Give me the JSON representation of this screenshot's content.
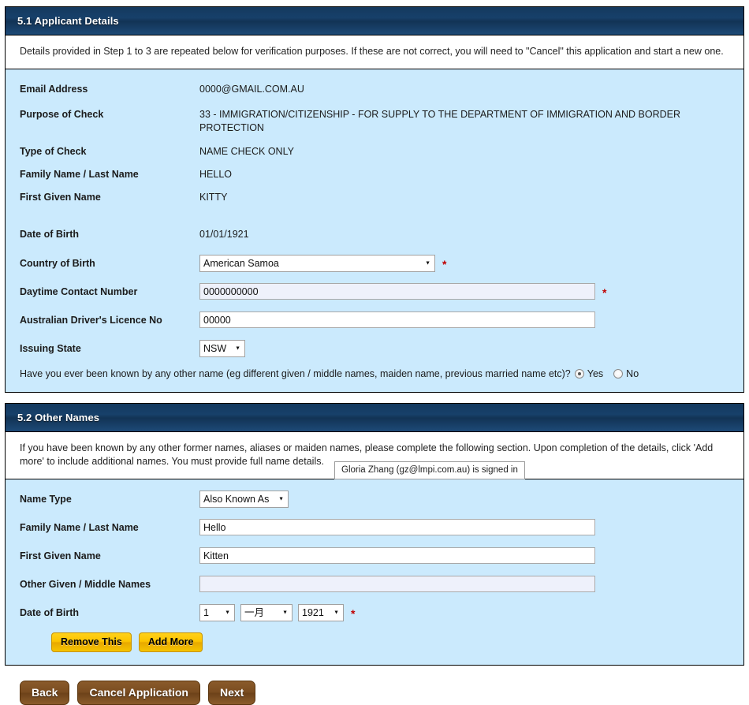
{
  "sections": [
    {
      "id": "applicant-details",
      "header": "5.1 Applicant Details",
      "intro": "Details provided in Step 1 to 3 are repeated below for verification purposes. If these are not correct, you will need to \"Cancel\" this application and start a new one.",
      "readonly_fields": [
        {
          "label": "Email Address",
          "value": "0000@GMAIL.COM.AU"
        },
        {
          "label": "Purpose of Check",
          "value": "33 - IMMIGRATION/CITIZENSHIP - FOR SUPPLY TO THE DEPARTMENT OF IMMIGRATION AND BORDER PROTECTION"
        },
        {
          "label": "Type of Check",
          "value": "NAME CHECK ONLY"
        },
        {
          "label": "Family Name / Last Name",
          "value": "HELLO"
        },
        {
          "label": "First Given Name",
          "value": "KITTY"
        },
        {
          "label": "Date of Birth",
          "value": "01/01/1921"
        }
      ],
      "country_of_birth": {
        "label": "Country of Birth",
        "value": "American Samoa",
        "required": "*"
      },
      "daytime_contact": {
        "label": "Daytime Contact Number",
        "value": "0000000000",
        "placeholder": "",
        "required": "*"
      },
      "licence_no": {
        "label": "Australian Driver's Licence No",
        "value": "00000",
        "placeholder": ""
      },
      "issuing_state": {
        "label": "Issuing State",
        "value": "NSW"
      },
      "other_name_question": {
        "text": "Have you ever been known by any other name (eg different given / middle names, maiden name, previous married name etc)?",
        "yes_label": "Yes",
        "no_label": "No",
        "selected": "Yes"
      }
    },
    {
      "id": "other-names",
      "header": "5.2 Other Names",
      "intro": "If you have been known by any other former names, aliases or maiden names, please complete the following section. Upon completion of the details, click 'Add more' to include additional names. You must provide full name details.",
      "name_type": {
        "label": "Name Type",
        "value": "Also Known As"
      },
      "family_name": {
        "label": "Family Name / Last Name",
        "value": "Hello",
        "placeholder": ""
      },
      "first_given_name": {
        "label": "First Given Name",
        "value": "Kitten",
        "placeholder": ""
      },
      "other_given_names": {
        "label": "Other Given / Middle Names",
        "value": "",
        "placeholder": ""
      },
      "date_of_birth": {
        "label": "Date of Birth",
        "day": "1",
        "month": "一月",
        "year": "1921",
        "required": "*"
      },
      "buttons": {
        "remove": "Remove This",
        "add": "Add More"
      }
    }
  ],
  "signed_in_tooltip": "Gloria Zhang (gz@lmpi.com.au) is signed in",
  "footer": {
    "back": "Back",
    "cancel": "Cancel Application",
    "next": "Next"
  },
  "colors": {
    "header_navy": "#14395e",
    "panel_blue": "#cbeafd",
    "required_red": "#c00000",
    "yellow_button": "#fcc400",
    "brown_button": "#7a4c20"
  }
}
